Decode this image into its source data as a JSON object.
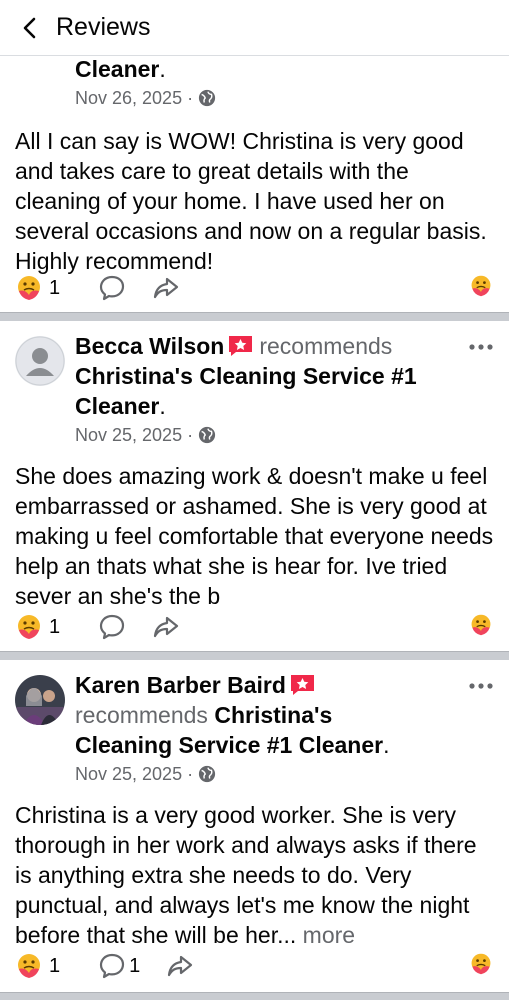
{
  "header": {
    "title": "Reviews"
  },
  "posts": [
    {
      "page_line2": "Cleaner",
      "period": ".",
      "date": "Nov 26, 2025",
      "dot": "·",
      "body": "All I can say is WOW! Christina is very good and takes care to great details with the cleaning of your home. I have used her on several occasions and now on a regular basis. Highly recommend!",
      "reaction_count": "1"
    },
    {
      "author": "Becca Wilson",
      "recommends": "recommends",
      "page_line1": "Christina's Cleaning Service #1",
      "page_line2": "Cleaner",
      "period": ".",
      "date": "Nov 25, 2025",
      "dot": "·",
      "body": "She does amazing work & doesn't make u feel embarrassed or ashamed. She is very good at making u feel comfortable that everyone needs help an thats what she is hear for. Ive tried sever an she's the b",
      "reaction_count": "1"
    },
    {
      "author": "Karen Barber Baird",
      "recommends": "recommends",
      "page_line1": "Christina's",
      "page_line2": "Cleaning Service #1 Cleaner",
      "period": ".",
      "date": "Nov 25, 2025",
      "dot": "·",
      "body": "Christina is a very good worker.  She is very thorough in her work and always asks if there is anything extra she needs to do. Very punctual, and always let's me know the night before that she will be her",
      "ellipsis": "...",
      "see_more": "more",
      "reaction_count": "1",
      "comment_count": "1"
    }
  ],
  "colors": {
    "accent": "#f02849",
    "muted": "#65676b",
    "divider": "#c9ccd1",
    "reaction": "#f7b928"
  },
  "icons": {
    "back": "chevron-left-icon",
    "globe": "globe-icon",
    "comment": "comment-icon",
    "share": "share-icon",
    "reaction": "care-reaction-icon",
    "more": "more-dots-icon",
    "recommend": "recommend-star-icon"
  }
}
